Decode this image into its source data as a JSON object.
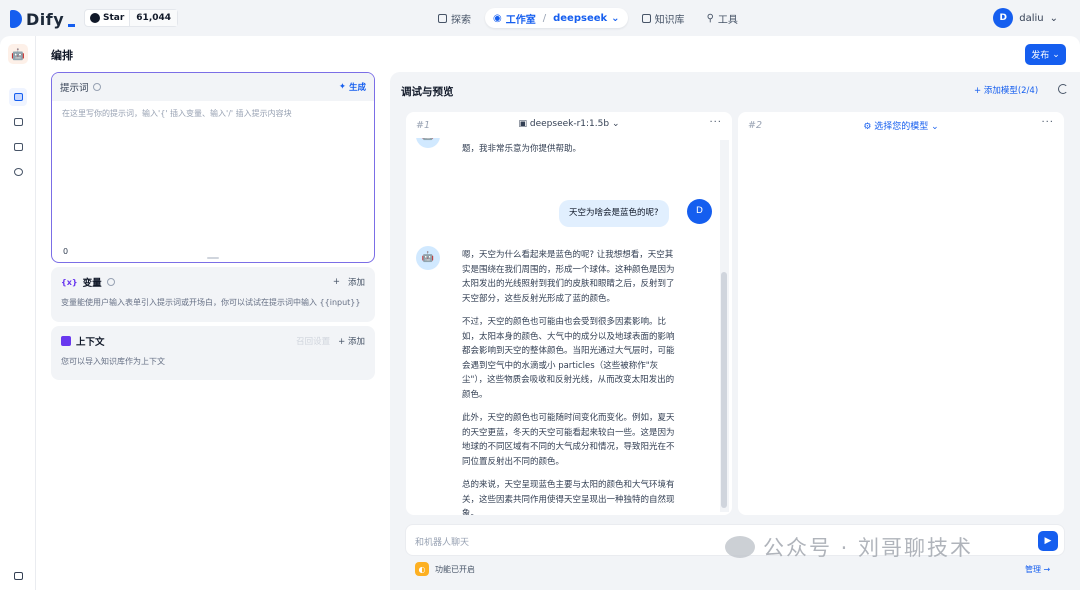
{
  "brand": {
    "name": "Dify",
    "github_label": "Star",
    "github_stars": "61,044"
  },
  "nav": {
    "explore": "探索",
    "studio": "工作室",
    "app_name": "deepseek",
    "knowledge": "知识库",
    "tools": "工具"
  },
  "user": {
    "initial": "D",
    "name": "daliu"
  },
  "page": {
    "title": "编排",
    "publish": "发布"
  },
  "prompt": {
    "label": "提示词",
    "generate": "生成",
    "placeholder": "在这里写你的提示词，输入'{' 插入变量、输入'/' 插入提示内容块",
    "count": "0"
  },
  "variables": {
    "label": "变量",
    "symbol": "{x}",
    "add": "添加",
    "desc": "变量能使用户输入表单引入提示词或开场白，你可以试试在提示词中输入 {{input}}"
  },
  "context": {
    "label": "上下文",
    "recall": "召回设置",
    "add": "添加",
    "desc": "您可以导入知识库作为上下文"
  },
  "debug": {
    "title": "调试与预览",
    "add_model": "添加模型(2/4)",
    "panel1": {
      "num": "#1",
      "model": "deepseek-r1:1.5b"
    },
    "panel2": {
      "num": "#2",
      "model": "选择您的模型"
    }
  },
  "chat": {
    "prev_fragment": "题，我非常乐意为你提供帮助。",
    "user_question": "天空为啥会是蓝色的呢?",
    "user_initial": "D",
    "answer": [
      "嗯，天空为什么看起来是蓝色的呢? 让我想想看，天空其实是围绕在我们周围的，形成一个球体。这种颜色是因为太阳发出的光线照射到我们的皮肤和眼睛之后，反射到了天空部分，这些反射光形成了蓝的颜色。",
      "不过，天空的颜色也可能由也会受到很多因素影响。比如，太阳本身的颜色、大气中的成分以及地球表面的影响都会影响到天空的整体颜色。当阳光通过大气层时，可能会遇到空气中的水滴或小 particles（这些被称作\"灰尘\"），这些物质会吸收和反射光线，从而改变太阳发出的颜色。",
      "此外，天空的颜色也可能随时间变化而变化。例如，夏天的天空更蓝，冬天的天空可能看起来较白一些。这是因为地球的不同区域有不同的大气成分和情况，导致阳光在不同位置反射出不同的颜色。",
      "总的来说，天空呈现蓝色主要与太阳的颜色和大气环境有关，这些因素共同作用使得天空呈现出一种独特的自然现象。"
    ]
  },
  "input": {
    "placeholder": "和机器人聊天"
  },
  "features": {
    "label": "功能已开启",
    "manage": "管理 →"
  },
  "watermark": "公众号 · 刘哥聊技术"
}
